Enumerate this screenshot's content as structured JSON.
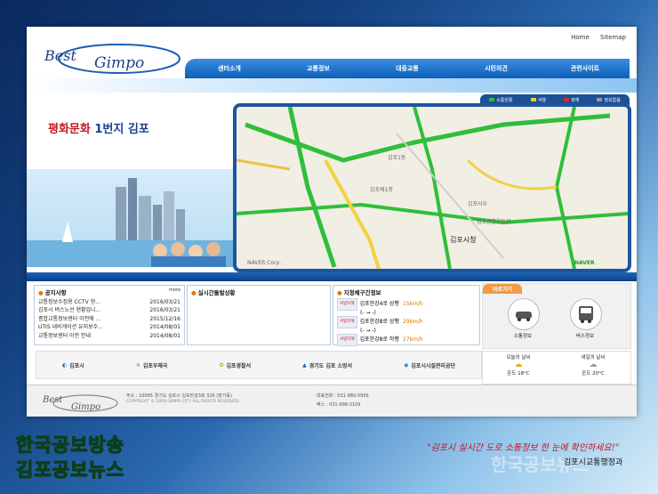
{
  "top_links": [
    "Home",
    "Sitemap"
  ],
  "logo_text": "Best Gimpo",
  "menu": [
    "센터소개",
    "교통정보",
    "대중교통",
    "시민의견",
    "관련사이트"
  ],
  "slogan": {
    "brand": "평화문화",
    "rest": "1번지 김포"
  },
  "legend": [
    {
      "label": "소통원활",
      "color": "#2fbf3a"
    },
    {
      "label": "서행",
      "color": "#e6d31a"
    },
    {
      "label": "정체",
      "color": "#d92a2a"
    },
    {
      "label": "정보없음",
      "color": "#999999"
    }
  ],
  "map": {
    "labels": [
      "김포시청",
      "김포1동",
      "김포제1청",
      "김포사우",
      "NAVER Corp.",
      "김포종합운동장",
      "NAVER"
    ]
  },
  "notice": {
    "title": "공지사항",
    "more": "more",
    "items": [
      {
        "text": "교통정보수집용 CCTV 현...",
        "date": "2016/03/21"
      },
      {
        "text": "김포시 버스노선 현황입니...",
        "date": "2016/03/21"
      },
      {
        "text": "종합교통정보센터 이전에 ...",
        "date": "2015/12/16"
      },
      {
        "text": "UTIS 내비게이션 유지보수...",
        "date": "2014/08/01"
      },
      {
        "text": "교통정보센터 이전 안내",
        "date": "2014/08/01"
      }
    ]
  },
  "incident": {
    "title": "실시간돌발상황"
  },
  "section": {
    "title": "지정체구간정보",
    "items": [
      {
        "tag": "서범지혜",
        "road": "김포한강4로 상행",
        "speed": "15km/h",
        "sub": "(- → -)"
      },
      {
        "tag": "서범지혜",
        "road": "김포한강8로 상행",
        "speed": "29km/h",
        "sub": "(- → -)"
      },
      {
        "tag": "서범지혜",
        "road": "김포한강8로 하행",
        "speed": "27km/h",
        "sub": ""
      }
    ]
  },
  "quick": {
    "title": "바로가기",
    "buttons": [
      "소통정보",
      "버스정보"
    ]
  },
  "partners": [
    "김포시",
    "김포우체국",
    "김포경찰서",
    "경기도 김포 소방서",
    "김포시시설관리공단"
  ],
  "weather": [
    {
      "label": "오늘의 날씨",
      "temp": "온도 18°C"
    },
    {
      "label": "내일의 날씨",
      "temp": "온도 20°C"
    }
  ],
  "footer": {
    "address": "주소 : 10065 경기도 김포시 김포한강3로 326 (장기동)",
    "copyright": "COPYRIGHT © 2009 GIMPO CITY. ALL RIGHTS RESERVED.",
    "tel": "대표전화 : 031-980-5956",
    "fax": "팩스 : 031-998-3109"
  },
  "overlay": {
    "brand1": "한국공보방송",
    "brand2": "김포공보뉴스",
    "caption": "\"김포시 실시간 도로 소통정보 한 눈에 확인하세요!\"",
    "caption_source": "김포시교통행정과",
    "watermark": "한국공보뉴스"
  }
}
